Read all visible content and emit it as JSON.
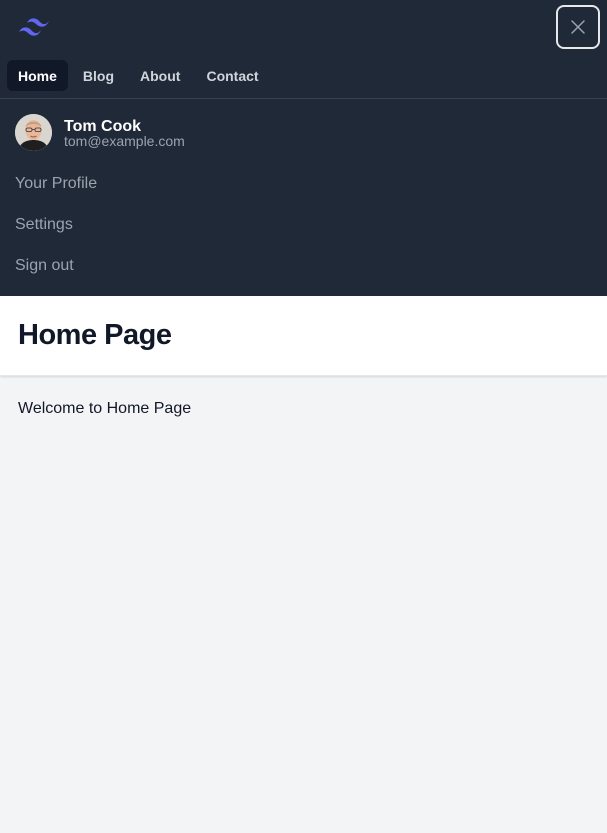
{
  "nav": {
    "logo_icon": "tailwind-logo-icon",
    "close_icon": "close-icon",
    "links": [
      {
        "label": "Home",
        "active": true
      },
      {
        "label": "Blog",
        "active": false
      },
      {
        "label": "About",
        "active": false
      },
      {
        "label": "Contact",
        "active": false
      }
    ]
  },
  "user": {
    "name": "Tom Cook",
    "email": "tom@example.com",
    "menu": [
      "Your Profile",
      "Settings",
      "Sign out"
    ]
  },
  "header": {
    "title": "Home Page"
  },
  "main": {
    "welcome": "Welcome to Home Page"
  },
  "colors": {
    "nav_bg": "#1f2937",
    "active_bg": "#111827",
    "accent": "#6366f1",
    "page_bg": "#f3f4f6"
  }
}
